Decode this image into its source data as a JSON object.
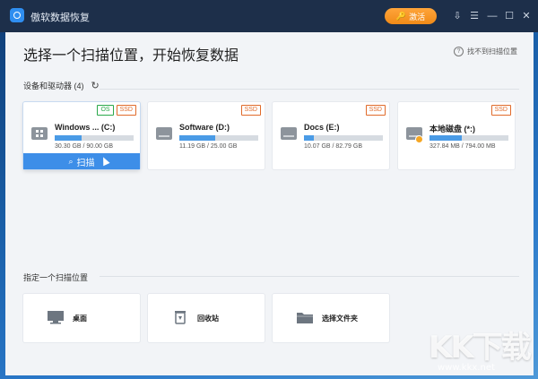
{
  "window": {
    "title": "傲软数据恢复",
    "upgrade_label": "激活",
    "upgrade_color": "#f59a2a"
  },
  "main": {
    "title": "选择一个扫描位置，开始恢复数据",
    "help_link": "找不到扫描位置"
  },
  "devices": {
    "header": "设备和驱动器 (4)",
    "items": [
      {
        "name": "Windows ... (C:)",
        "size": "30.30 GB / 90.00 GB",
        "usage": 0.34,
        "badges": [
          "OS",
          "SSD"
        ],
        "icon": "windows-drive-icon",
        "selected": true,
        "scan_label": "扫描"
      },
      {
        "name": "Software (D:)",
        "size": "11.19 GB / 25.00 GB",
        "usage": 0.45,
        "badges": [
          "SSD"
        ],
        "icon": "drive-icon"
      },
      {
        "name": "Docs (E:)",
        "size": "10.07 GB / 82.79 GB",
        "usage": 0.12,
        "badges": [
          "SSD"
        ],
        "icon": "drive-icon"
      },
      {
        "name": "本地磁盘 (*:)",
        "size": "327.84 MB / 794.00 MB",
        "usage": 0.41,
        "badges": [
          "SSD"
        ],
        "icon": "warning-drive-icon"
      }
    ]
  },
  "locations": {
    "header": "指定一个扫描位置",
    "items": [
      {
        "label": "桌面",
        "icon": "desktop-icon"
      },
      {
        "label": "回收站",
        "icon": "recycle-bin-icon"
      },
      {
        "label": "选择文件夹",
        "icon": "folder-icon"
      }
    ]
  },
  "watermark": {
    "logo": "KK下载",
    "url": "www.kkx.net"
  },
  "colors": {
    "accent": "#3d8ee8",
    "titlebar": "#1d2f4a",
    "os_badge": "#2aa84a",
    "ssd_badge": "#e06b2b"
  }
}
